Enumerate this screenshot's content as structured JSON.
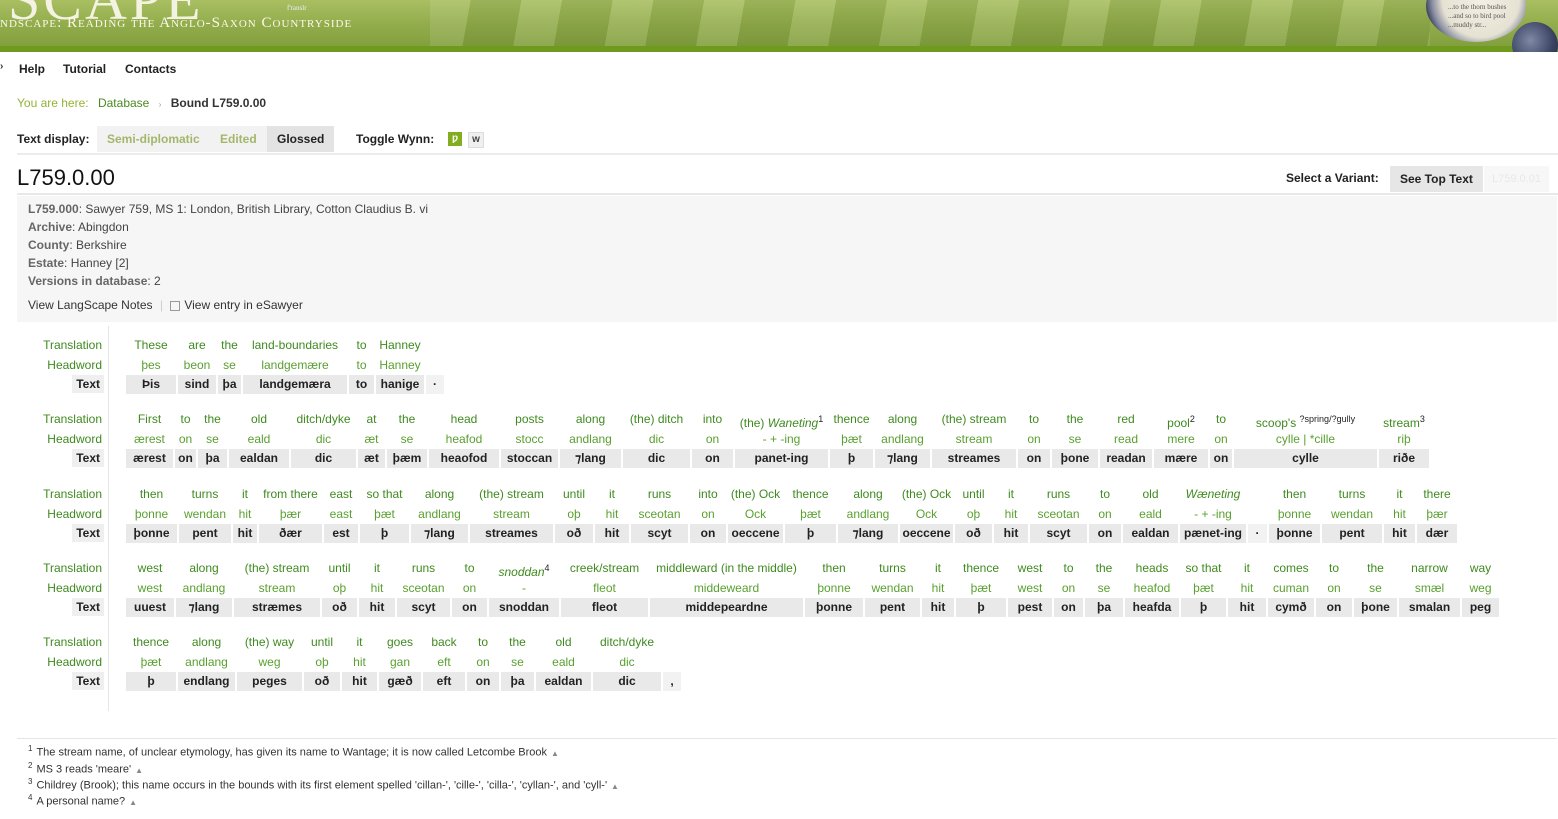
{
  "banner": {
    "logo_text": "SCAPE",
    "subtitle": "ndscape: Reading the Anglo-Saxon Countryside",
    "small_text": "f'ranslr",
    "lens_text": "...to the thorn bushes ...and so to bird pool ...muddy str..."
  },
  "nav": {
    "items": [
      "Help",
      "Tutorial",
      "Contacts"
    ]
  },
  "breadcrumb": {
    "label": "You are here:",
    "link": "Database",
    "separator": "›",
    "current": "Bound L759.0.00"
  },
  "text_display": {
    "label": "Text display:",
    "modes": [
      "Semi-diplomatic",
      "Edited",
      "Glossed"
    ],
    "active": "Glossed",
    "wynn_label": "Toggle Wynn:",
    "wynn_on": "ƿ",
    "wynn_off": "w"
  },
  "record": {
    "id": "L759.0.00",
    "variant_label": "Select a Variant:",
    "see_top": "See Top Text",
    "other_variant": "L759.0.01"
  },
  "meta": {
    "heading_key": "L759.000",
    "heading_val": ": Sawyer 759, MS 1: London, British Library, Cotton Claudius B. vi",
    "archive_key": "Archive",
    "archive_val": ": Abingdon",
    "county_key": "County",
    "county_val": ": Berkshire",
    "estate_key": "Estate",
    "estate_val": ": Hanney [2]",
    "versions_key": "Versions in database",
    "versions_val": ": 2",
    "notes_link": "View LangScape Notes",
    "esawyer_link": "View entry in eSawyer"
  },
  "row_labels": {
    "translation": "Translation",
    "headword": "Headword",
    "text": "Text"
  },
  "gloss_rows": [
    [
      [
        "These",
        "þes",
        "Þis"
      ],
      [
        "are",
        "beon",
        "sind"
      ],
      [
        "the",
        "se",
        "þa"
      ],
      [
        "land-boundaries",
        "landgemære",
        "landgemæra"
      ],
      [
        "to",
        "to",
        "to"
      ],
      [
        "Hanney",
        "Hanney",
        "hanige"
      ],
      [
        "",
        "",
        "·"
      ]
    ],
    [
      [
        "First",
        "ærest",
        "ærest"
      ],
      [
        "to",
        "on",
        "on"
      ],
      [
        "the",
        "se",
        "þa"
      ],
      [
        "old",
        "eald",
        "ealdan"
      ],
      [
        "ditch/dyke",
        "dic",
        "dic"
      ],
      [
        "at",
        "æt",
        "æt"
      ],
      [
        "the",
        "se",
        "þæm"
      ],
      [
        "head",
        "heafod",
        "heaofod"
      ],
      [
        "posts",
        "stocc",
        "stoccan"
      ],
      [
        "along",
        "andlang",
        "⁊lang"
      ],
      [
        "(the) ditch",
        "dic",
        "dic"
      ],
      [
        "into",
        "on",
        "on"
      ],
      [
        "(the) Waneting|1",
        "- + -ing",
        "panet-ing"
      ],
      [
        "thence",
        "þæt",
        "þ"
      ],
      [
        "along",
        "andlang",
        "⁊lang"
      ],
      [
        "(the) stream",
        "stream",
        "streames"
      ],
      [
        "to",
        "on",
        "on"
      ],
      [
        "the",
        "se",
        "þone"
      ],
      [
        "red",
        "read",
        "readan"
      ],
      [
        "pool|2",
        "mere",
        "mære"
      ],
      [
        "to",
        "on",
        "on"
      ],
      [
        "scoop's | ?spring/?gully",
        "cylle | *cille",
        "cylle"
      ],
      [
        "stream|3",
        "riþ",
        "riðe"
      ]
    ],
    [
      [
        "then",
        "þonne",
        "þonne"
      ],
      [
        "turns",
        "wendan",
        "pent"
      ],
      [
        "it",
        "hit",
        "hit"
      ],
      [
        "from there",
        "þær",
        "ðær"
      ],
      [
        "east",
        "east",
        "est"
      ],
      [
        "so that",
        "þæt",
        "þ"
      ],
      [
        "along",
        "andlang",
        "⁊lang"
      ],
      [
        "(the) stream",
        "stream",
        "streames"
      ],
      [
        "until",
        "oþ",
        "oð"
      ],
      [
        "it",
        "hit",
        "hit"
      ],
      [
        "runs",
        "sceotan",
        "scyt"
      ],
      [
        "into",
        "on",
        "on"
      ],
      [
        "(the) Ock",
        "Ock",
        "oeccene"
      ],
      [
        "thence",
        "þæt",
        "þ"
      ],
      [
        "along",
        "andlang",
        "⁊lang"
      ],
      [
        "(the) Ock",
        "Ock",
        "oeccene"
      ],
      [
        "until",
        "oþ",
        "oð"
      ],
      [
        "it",
        "hit",
        "hit"
      ],
      [
        "runs",
        "sceotan",
        "scyt"
      ],
      [
        "to",
        "on",
        "on"
      ],
      [
        "old",
        "eald",
        "ealdan"
      ],
      [
        "Wæneting",
        "- + -ing",
        "pænet-ing"
      ],
      [
        "",
        "",
        "·"
      ],
      [
        "then",
        "þonne",
        "þonne"
      ],
      [
        "turns",
        "wendan",
        "pent"
      ],
      [
        "it",
        "hit",
        "hit"
      ],
      [
        "there",
        "þær",
        "dær"
      ]
    ],
    [
      [
        "west",
        "west",
        "uuest"
      ],
      [
        "along",
        "andlang",
        "⁊lang"
      ],
      [
        "(the) stream",
        "stream",
        "stræmes"
      ],
      [
        "until",
        "oþ",
        "oð"
      ],
      [
        "it",
        "hit",
        "hit"
      ],
      [
        "runs",
        "sceotan",
        "scyt"
      ],
      [
        "to",
        "on",
        "on"
      ],
      [
        "snoddan|4",
        "-",
        "snoddan"
      ],
      [
        "creek/stream",
        "fleot",
        "fleot"
      ],
      [
        "middleward (in the middle)",
        "middeweard",
        "middepeardne"
      ],
      [
        "then",
        "þonne",
        "þonne"
      ],
      [
        "turns",
        "wendan",
        "pent"
      ],
      [
        "it",
        "hit",
        "hit"
      ],
      [
        "thence",
        "þæt",
        "þ"
      ],
      [
        "west",
        "west",
        "pest"
      ],
      [
        "to",
        "on",
        "on"
      ],
      [
        "the",
        "se",
        "þa"
      ],
      [
        "heads",
        "heafod",
        "heafda"
      ],
      [
        "so that",
        "þæt",
        "þ"
      ],
      [
        "it",
        "hit",
        "hit"
      ],
      [
        "comes",
        "cuman",
        "cymð"
      ],
      [
        "to",
        "on",
        "on"
      ],
      [
        "the",
        "se",
        "þone"
      ],
      [
        "narrow",
        "smæl",
        "smalan"
      ],
      [
        "way",
        "weg",
        "peg"
      ]
    ],
    [
      [
        "thence",
        "þæt",
        "þ"
      ],
      [
        "along",
        "andlang",
        "endlang"
      ],
      [
        "(the) way",
        "weg",
        "peges"
      ],
      [
        "until",
        "oþ",
        "oð"
      ],
      [
        "it",
        "hit",
        "hit"
      ],
      [
        "goes",
        "gan",
        "gæð"
      ],
      [
        "back",
        "eft",
        "eft"
      ],
      [
        "to",
        "on",
        "on"
      ],
      [
        "the",
        "se",
        "þa"
      ],
      [
        "old",
        "eald",
        "ealdan"
      ],
      [
        "ditch/dyke",
        "dic",
        "dic"
      ],
      [
        "",
        "",
        ","
      ]
    ]
  ],
  "footnotes": [
    {
      "n": "1",
      "text": "The stream name, of unclear etymology, has given its name to Wantage; it is now called Letcombe Brook"
    },
    {
      "n": "2",
      "text": "MS 3 reads 'meare'"
    },
    {
      "n": "3",
      "text": "Childrey (Brook); this name occurs in the bounds with its first element spelled 'cillan-', 'cille-', 'cilla-', 'cyllan-', and 'cyll-'"
    },
    {
      "n": "4",
      "text": "A personal name?"
    }
  ],
  "footnote_up": "▲"
}
